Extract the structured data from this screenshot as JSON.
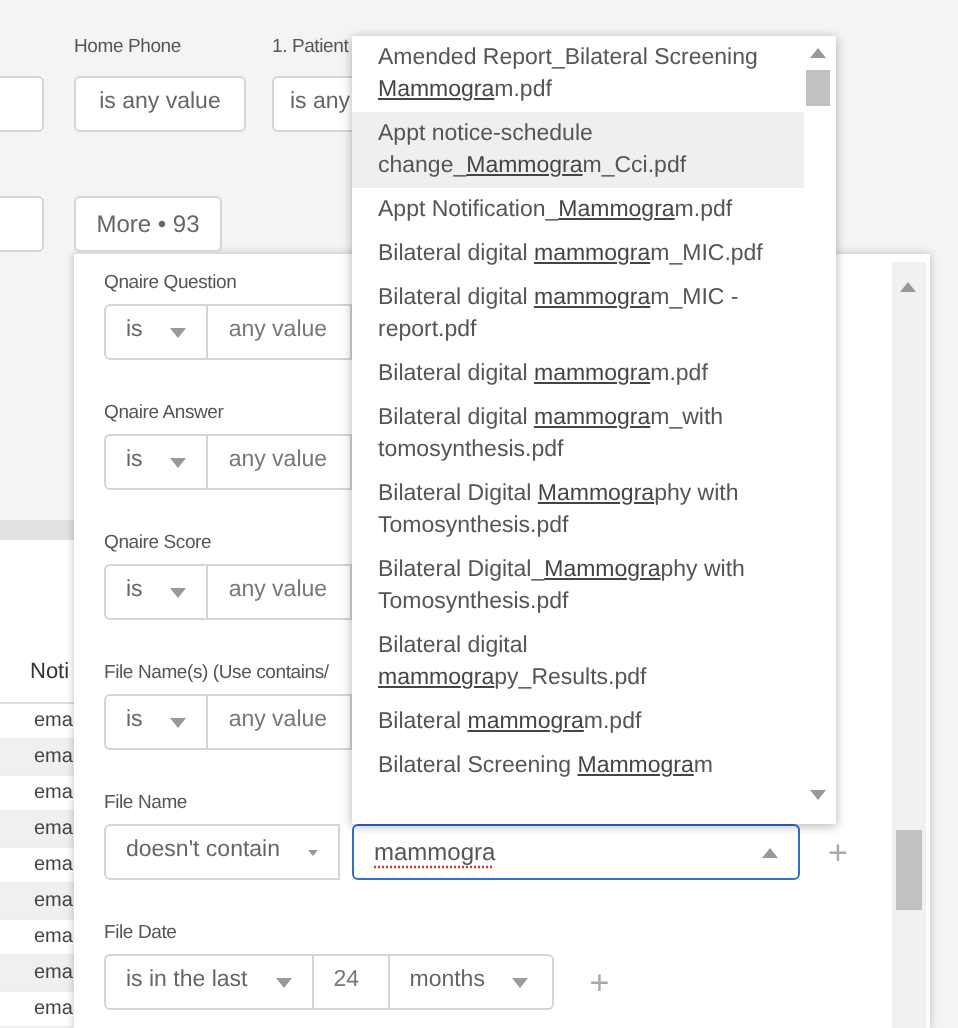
{
  "top_filters": {
    "labels": [
      "Home Phone",
      "1. Patient"
    ],
    "buttons": [
      "is any value",
      "is any"
    ],
    "more_button": "More • 93"
  },
  "table": {
    "header": "Noti",
    "rows": [
      "ema",
      "ema",
      "ema",
      "ema",
      "ema",
      "ema",
      "ema",
      "ema",
      "ema"
    ]
  },
  "filters": [
    {
      "kind": "operator_value",
      "label": "Qnaire Question",
      "operator": "is",
      "value_placeholder": "any value"
    },
    {
      "kind": "operator_value",
      "label": "Qnaire Answer",
      "operator": "is",
      "value_placeholder": "any value"
    },
    {
      "kind": "operator_value",
      "label": "Qnaire Score",
      "operator": "is",
      "value_placeholder": "any value"
    },
    {
      "kind": "operator_value",
      "label": "File Name(s) (Use contains/",
      "operator": "is",
      "value_placeholder": "any value"
    },
    {
      "kind": "search",
      "label": "File Name",
      "operator": "doesn't contain",
      "value": "mammogra",
      "plus": "+"
    },
    {
      "kind": "date",
      "label": "File Date",
      "operator": "is in the last",
      "amount": "24",
      "unit": "months",
      "plus": "+"
    }
  ],
  "dropdown": {
    "options": [
      {
        "text": "Amended Report_Bilateral Screening **Mammogra**m.pdf",
        "selected": false
      },
      {
        "text": "Appt notice-schedule change_**Mammogra**m_Cci.pdf",
        "selected": true
      },
      {
        "text": "Appt Notification_**Mammogra**m.pdf",
        "selected": false
      },
      {
        "text": "Bilateral digital **mammogra**m_MIC.pdf",
        "selected": false
      },
      {
        "text": "Bilateral digital **mammogra**m_MIC - report.pdf",
        "selected": false
      },
      {
        "text": "Bilateral digital **mammogra**m.pdf",
        "selected": false
      },
      {
        "text": "Bilateral digital **mammogra**m_with tomosynthesis.pdf",
        "selected": false
      },
      {
        "text": "Bilateral Digital **Mammogra**phy with Tomosynthesis.pdf",
        "selected": false
      },
      {
        "text": "Bilateral Digital_**Mammogra**phy with Tomosynthesis.pdf",
        "selected": false
      },
      {
        "text": "Bilateral digital **mammogra**py_Results.pdf",
        "selected": false
      },
      {
        "text": "Bilateral **mammogra**m.pdf",
        "selected": false
      },
      {
        "text": "Bilateral Screening **Mammogra**m",
        "selected": false
      }
    ]
  }
}
